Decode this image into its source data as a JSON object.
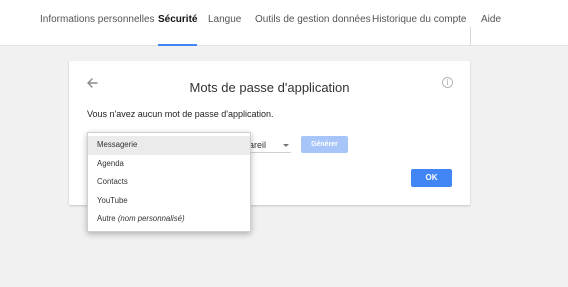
{
  "nav": {
    "tabs": [
      {
        "label": "Informations personnelles",
        "active": false
      },
      {
        "label": "Sécurité",
        "active": true
      },
      {
        "label": "Langue",
        "active": false
      },
      {
        "label": "Outils de gestion données",
        "active": false
      },
      {
        "label": "Historique du compte",
        "active": false
      },
      {
        "label": "Aide",
        "active": false
      }
    ]
  },
  "card": {
    "title": "Mots de passe d'application",
    "message": "Vous n'avez aucun mot de passe d'application.",
    "device_select": "ppareil",
    "generate_label": "Générer",
    "ok_label": "OK",
    "info_icon": "i"
  },
  "dropdown": {
    "options": [
      {
        "label": "Messagerie",
        "selected": true
      },
      {
        "label": "Agenda",
        "selected": false
      },
      {
        "label": "Contacts",
        "selected": false
      },
      {
        "label": "YouTube",
        "selected": false
      },
      {
        "label": "Autre",
        "suffix": "(nom personnalisé)",
        "selected": false
      }
    ]
  },
  "colors": {
    "accent": "#4285f4",
    "disabled_button": "#a7c5f8",
    "background": "#f1f1f1"
  },
  "icons": {
    "back": "back-arrow-icon",
    "info": "info-icon",
    "caret": "chevron-down-icon"
  }
}
